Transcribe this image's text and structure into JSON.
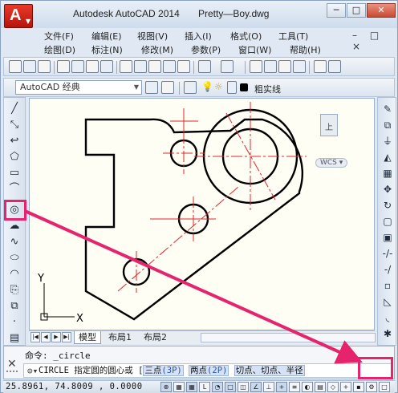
{
  "window": {
    "app_title": "Autodesk AutoCAD 2014",
    "file_name": "Pretty—Boy.dwg",
    "logo_letter": "A",
    "controls": {
      "minimize": "─",
      "maximize": "□",
      "close": "✕"
    }
  },
  "menu": {
    "row1": [
      "文件(F)",
      "编辑(E)",
      "视图(V)",
      "插入(I)",
      "格式(O)",
      "工具(T)"
    ],
    "row2": [
      "绘图(D)",
      "标注(N)",
      "修改(M)",
      "参数(P)",
      "窗口(W)",
      "帮助(H)"
    ],
    "doc_controls": "– □ ×"
  },
  "workspace": {
    "name": "AutoCAD 经典",
    "layer_linetype": "粗实线"
  },
  "left_palette": {
    "tools": [
      "line-icon",
      "construction-line-icon",
      "polyline-icon",
      "polygon-icon",
      "rectangle-icon",
      "arc-icon",
      "circle-icon",
      "revision-cloud-icon",
      "spline-icon",
      "ellipse-icon",
      "ellipse-arc-icon",
      "insert-block-icon",
      "make-block-icon",
      "point-icon",
      "hatch-icon"
    ]
  },
  "canvas": {
    "viewcube_face": "上",
    "wcs_label": "WCS",
    "ucs_x": "X",
    "ucs_y": "Y"
  },
  "tabs": {
    "items": [
      "模型",
      "布局1",
      "布局2"
    ],
    "active": "模型"
  },
  "command": {
    "history": "命令: _circle",
    "prompt_name": "CIRCLE",
    "prompt_text": "指定圆的圆心或",
    "options": [
      {
        "label": "三点",
        "key": "(3P)"
      },
      {
        "label": "两点",
        "key": "(2P)"
      },
      {
        "label": "切点、切点、半径",
        "key": ""
      }
    ]
  },
  "status": {
    "coordinates": "25.8961,  74.8009 , 0.0000"
  },
  "colors": {
    "highlight": "#e5246d",
    "canvas_bg": "#fffef4",
    "centerline": "#e0252b",
    "logo_red": "#d32a1c"
  }
}
